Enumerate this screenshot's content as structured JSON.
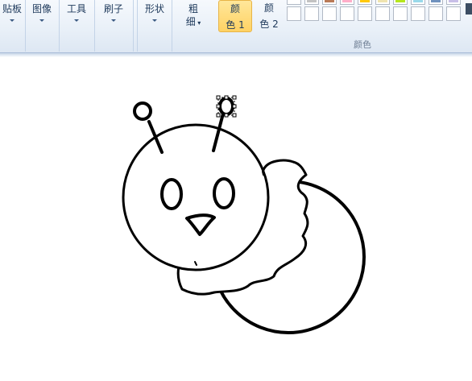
{
  "toolbar": {
    "clipboard_label": "贴板",
    "image_label": "图像",
    "tools_label": "工具",
    "brushes_label": "刷子",
    "shapes_label": "形状",
    "size_label_top": "粗",
    "size_label_bottom": "细",
    "color1_top": "颜",
    "color1_bottom": "色 1",
    "color2_top": "颜",
    "color2_bottom": "色 2",
    "colors_group_label": "颜色"
  },
  "palette": {
    "row1": [
      "#ffffff",
      "#c3c3c3",
      "#b97a57",
      "#ffaec9",
      "#ffc90e",
      "#efe4b0",
      "#b5e61d",
      "#99d9ea",
      "#7092be",
      "#c8bfe7"
    ],
    "row2": [
      "#ffffff",
      "#ffffff",
      "#ffffff",
      "#ffffff",
      "#ffffff",
      "#ffffff",
      "#ffffff",
      "#ffffff",
      "#ffffff",
      "#ffffff"
    ]
  },
  "colors": {
    "ribbon_bg": "#e9f0f8",
    "text": "#1e395b",
    "active_highlight": "#ffd264",
    "stroke": "#000000"
  }
}
